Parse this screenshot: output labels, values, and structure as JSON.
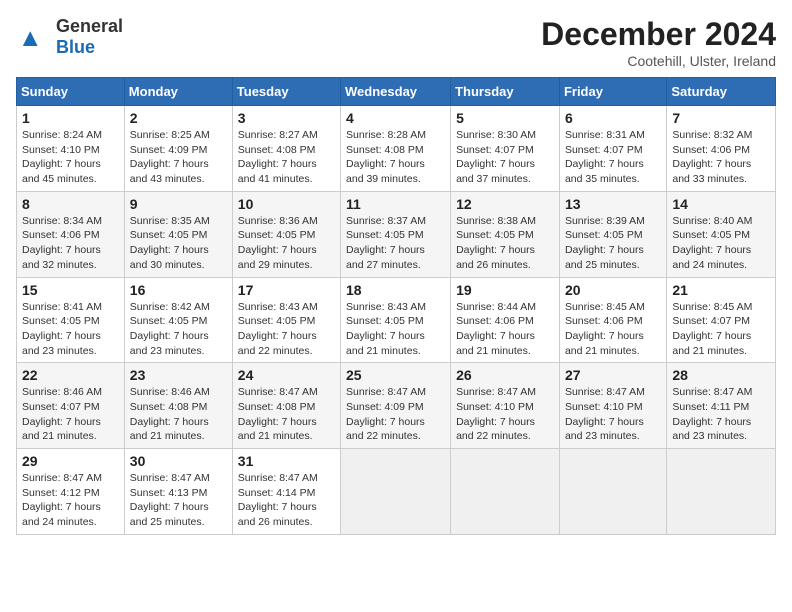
{
  "header": {
    "logo_general": "General",
    "logo_blue": "Blue",
    "month_title": "December 2024",
    "location": "Cootehill, Ulster, Ireland"
  },
  "days_of_week": [
    "Sunday",
    "Monday",
    "Tuesday",
    "Wednesday",
    "Thursday",
    "Friday",
    "Saturday"
  ],
  "weeks": [
    [
      {
        "day": "1",
        "sunrise": "8:24 AM",
        "sunset": "4:10 PM",
        "daylight": "7 hours and 45 minutes."
      },
      {
        "day": "2",
        "sunrise": "8:25 AM",
        "sunset": "4:09 PM",
        "daylight": "7 hours and 43 minutes."
      },
      {
        "day": "3",
        "sunrise": "8:27 AM",
        "sunset": "4:08 PM",
        "daylight": "7 hours and 41 minutes."
      },
      {
        "day": "4",
        "sunrise": "8:28 AM",
        "sunset": "4:08 PM",
        "daylight": "7 hours and 39 minutes."
      },
      {
        "day": "5",
        "sunrise": "8:30 AM",
        "sunset": "4:07 PM",
        "daylight": "7 hours and 37 minutes."
      },
      {
        "day": "6",
        "sunrise": "8:31 AM",
        "sunset": "4:07 PM",
        "daylight": "7 hours and 35 minutes."
      },
      {
        "day": "7",
        "sunrise": "8:32 AM",
        "sunset": "4:06 PM",
        "daylight": "7 hours and 33 minutes."
      }
    ],
    [
      {
        "day": "8",
        "sunrise": "8:34 AM",
        "sunset": "4:06 PM",
        "daylight": "7 hours and 32 minutes."
      },
      {
        "day": "9",
        "sunrise": "8:35 AM",
        "sunset": "4:05 PM",
        "daylight": "7 hours and 30 minutes."
      },
      {
        "day": "10",
        "sunrise": "8:36 AM",
        "sunset": "4:05 PM",
        "daylight": "7 hours and 29 minutes."
      },
      {
        "day": "11",
        "sunrise": "8:37 AM",
        "sunset": "4:05 PM",
        "daylight": "7 hours and 27 minutes."
      },
      {
        "day": "12",
        "sunrise": "8:38 AM",
        "sunset": "4:05 PM",
        "daylight": "7 hours and 26 minutes."
      },
      {
        "day": "13",
        "sunrise": "8:39 AM",
        "sunset": "4:05 PM",
        "daylight": "7 hours and 25 minutes."
      },
      {
        "day": "14",
        "sunrise": "8:40 AM",
        "sunset": "4:05 PM",
        "daylight": "7 hours and 24 minutes."
      }
    ],
    [
      {
        "day": "15",
        "sunrise": "8:41 AM",
        "sunset": "4:05 PM",
        "daylight": "7 hours and 23 minutes."
      },
      {
        "day": "16",
        "sunrise": "8:42 AM",
        "sunset": "4:05 PM",
        "daylight": "7 hours and 23 minutes."
      },
      {
        "day": "17",
        "sunrise": "8:43 AM",
        "sunset": "4:05 PM",
        "daylight": "7 hours and 22 minutes."
      },
      {
        "day": "18",
        "sunrise": "8:43 AM",
        "sunset": "4:05 PM",
        "daylight": "7 hours and 21 minutes."
      },
      {
        "day": "19",
        "sunrise": "8:44 AM",
        "sunset": "4:06 PM",
        "daylight": "7 hours and 21 minutes."
      },
      {
        "day": "20",
        "sunrise": "8:45 AM",
        "sunset": "4:06 PM",
        "daylight": "7 hours and 21 minutes."
      },
      {
        "day": "21",
        "sunrise": "8:45 AM",
        "sunset": "4:07 PM",
        "daylight": "7 hours and 21 minutes."
      }
    ],
    [
      {
        "day": "22",
        "sunrise": "8:46 AM",
        "sunset": "4:07 PM",
        "daylight": "7 hours and 21 minutes."
      },
      {
        "day": "23",
        "sunrise": "8:46 AM",
        "sunset": "4:08 PM",
        "daylight": "7 hours and 21 minutes."
      },
      {
        "day": "24",
        "sunrise": "8:47 AM",
        "sunset": "4:08 PM",
        "daylight": "7 hours and 21 minutes."
      },
      {
        "day": "25",
        "sunrise": "8:47 AM",
        "sunset": "4:09 PM",
        "daylight": "7 hours and 22 minutes."
      },
      {
        "day": "26",
        "sunrise": "8:47 AM",
        "sunset": "4:10 PM",
        "daylight": "7 hours and 22 minutes."
      },
      {
        "day": "27",
        "sunrise": "8:47 AM",
        "sunset": "4:10 PM",
        "daylight": "7 hours and 23 minutes."
      },
      {
        "day": "28",
        "sunrise": "8:47 AM",
        "sunset": "4:11 PM",
        "daylight": "7 hours and 23 minutes."
      }
    ],
    [
      {
        "day": "29",
        "sunrise": "8:47 AM",
        "sunset": "4:12 PM",
        "daylight": "7 hours and 24 minutes."
      },
      {
        "day": "30",
        "sunrise": "8:47 AM",
        "sunset": "4:13 PM",
        "daylight": "7 hours and 25 minutes."
      },
      {
        "day": "31",
        "sunrise": "8:47 AM",
        "sunset": "4:14 PM",
        "daylight": "7 hours and 26 minutes."
      },
      null,
      null,
      null,
      null
    ]
  ]
}
